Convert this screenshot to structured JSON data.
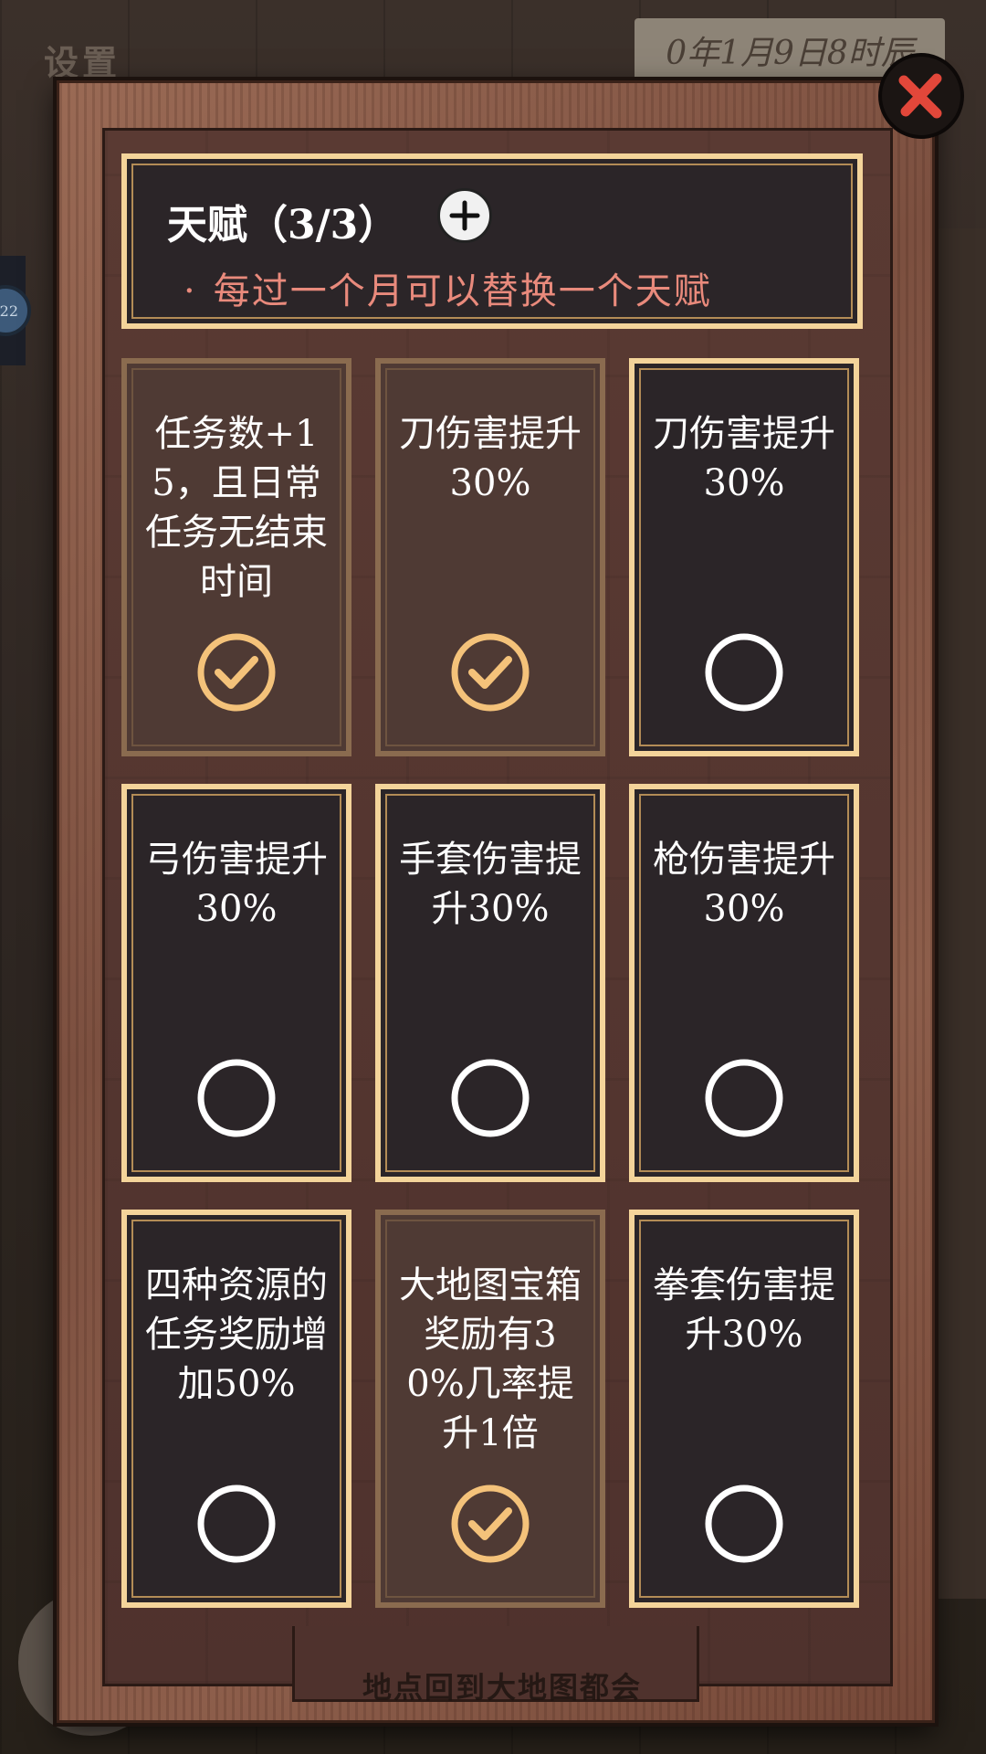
{
  "background": {
    "settings_label": "设置",
    "date_label": "0年1月9日8时辰",
    "badge_label": "22",
    "bottom_label": "地点回到大地图都会"
  },
  "header": {
    "title": "天赋（3/3）",
    "hint_bullet": "·",
    "hint": "每过一个月可以替换一个天赋"
  },
  "icons": {
    "close": "close-icon",
    "plus": "plus-icon",
    "check": "check-circle-icon",
    "empty": "empty-circle-icon"
  },
  "colors": {
    "selected_check": "#f4c27a",
    "unselected_ring": "#ffffff",
    "hint_text": "#e98a7c",
    "gold_border": "#f4d49a",
    "close_x": "#e2473a"
  },
  "talents": [
    {
      "text": "任务数+15，且日常任务无结束时间",
      "selected": true
    },
    {
      "text": "刀伤害提升30%",
      "selected": true
    },
    {
      "text": "刀伤害提升30%",
      "selected": false
    },
    {
      "text": "弓伤害提升30%",
      "selected": false
    },
    {
      "text": "手套伤害提升30%",
      "selected": false
    },
    {
      "text": "枪伤害提升30%",
      "selected": false
    },
    {
      "text": "四种资源的任务奖励增加50%",
      "selected": false
    },
    {
      "text": "大地图宝箱奖励有30%几率提升1倍",
      "selected": true
    },
    {
      "text": "拳套伤害提升30%",
      "selected": false
    }
  ]
}
